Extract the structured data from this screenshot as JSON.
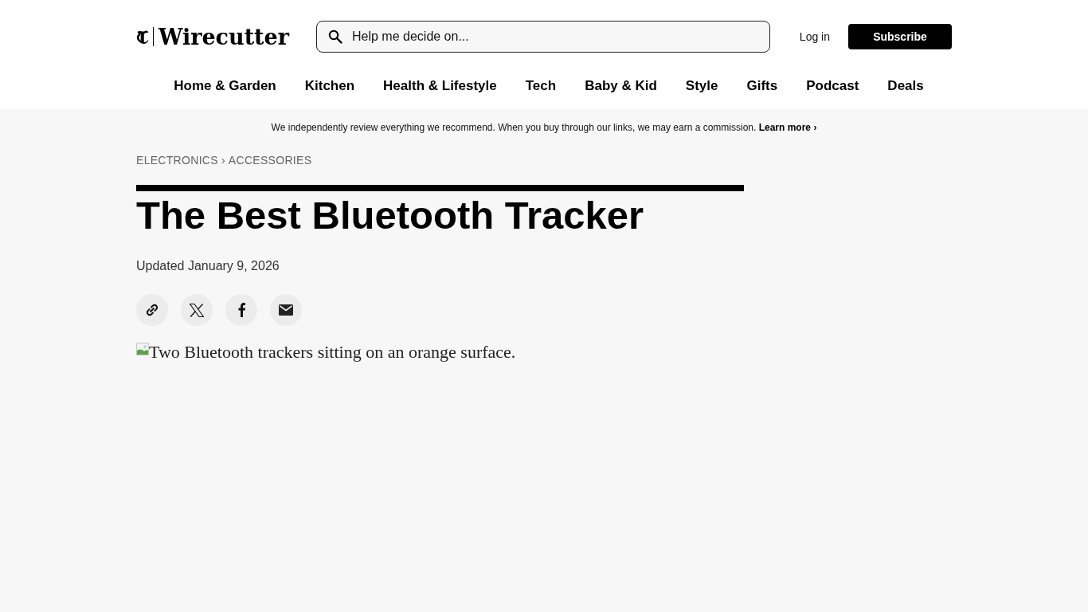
{
  "header": {
    "logo": {
      "wordmark": "Wirecutter"
    },
    "search": {
      "placeholder": "Help me decide on..."
    },
    "login": "Log in",
    "subscribe": "Subscribe"
  },
  "nav": [
    {
      "label": "Home & Garden"
    },
    {
      "label": "Kitchen"
    },
    {
      "label": "Health & Lifestyle"
    },
    {
      "label": "Tech"
    },
    {
      "label": "Baby & Kid"
    },
    {
      "label": "Style"
    },
    {
      "label": "Gifts"
    },
    {
      "label": "Podcast"
    },
    {
      "label": "Deals"
    }
  ],
  "disclosure": {
    "text": "We independently review everything we recommend. When you buy through our links, we may earn a commission.",
    "link": "Learn more ›"
  },
  "breadcrumbs": {
    "items": [
      "ELECTRONICS",
      "ACCESSORIES"
    ],
    "separator": "›"
  },
  "article": {
    "title": "The Best Bluetooth Tracker",
    "updated": "Updated January 9, 2026",
    "share": [
      {
        "kind": "link"
      },
      {
        "kind": "x"
      },
      {
        "kind": "facebook"
      },
      {
        "kind": "email"
      }
    ],
    "image": {
      "alt": "Two Bluetooth trackers sitting on an orange surface."
    }
  }
}
